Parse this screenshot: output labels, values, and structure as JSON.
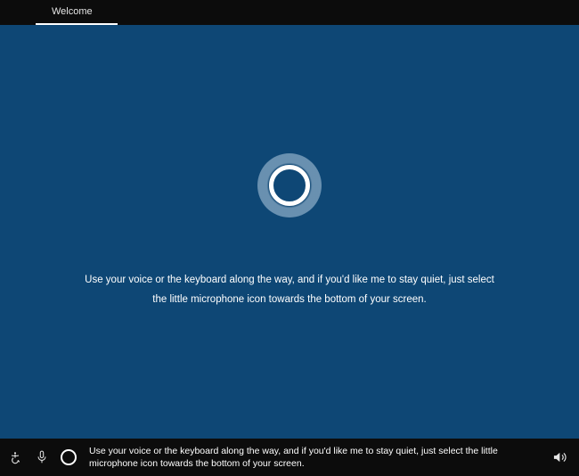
{
  "tabs": {
    "welcome": "Welcome"
  },
  "main": {
    "instruction": "Use your voice or the keyboard along the way, and if you'd like me to stay quiet, just select the little microphone icon towards the bottom of your screen."
  },
  "bottombar": {
    "caption": "Use your voice or the keyboard along the way, and if you'd like me to stay quiet, just select the little microphone icon towards the bottom of your screen."
  },
  "colors": {
    "background_blue": "#0e4775",
    "black": "#0c0c0c",
    "white": "#ffffff"
  }
}
